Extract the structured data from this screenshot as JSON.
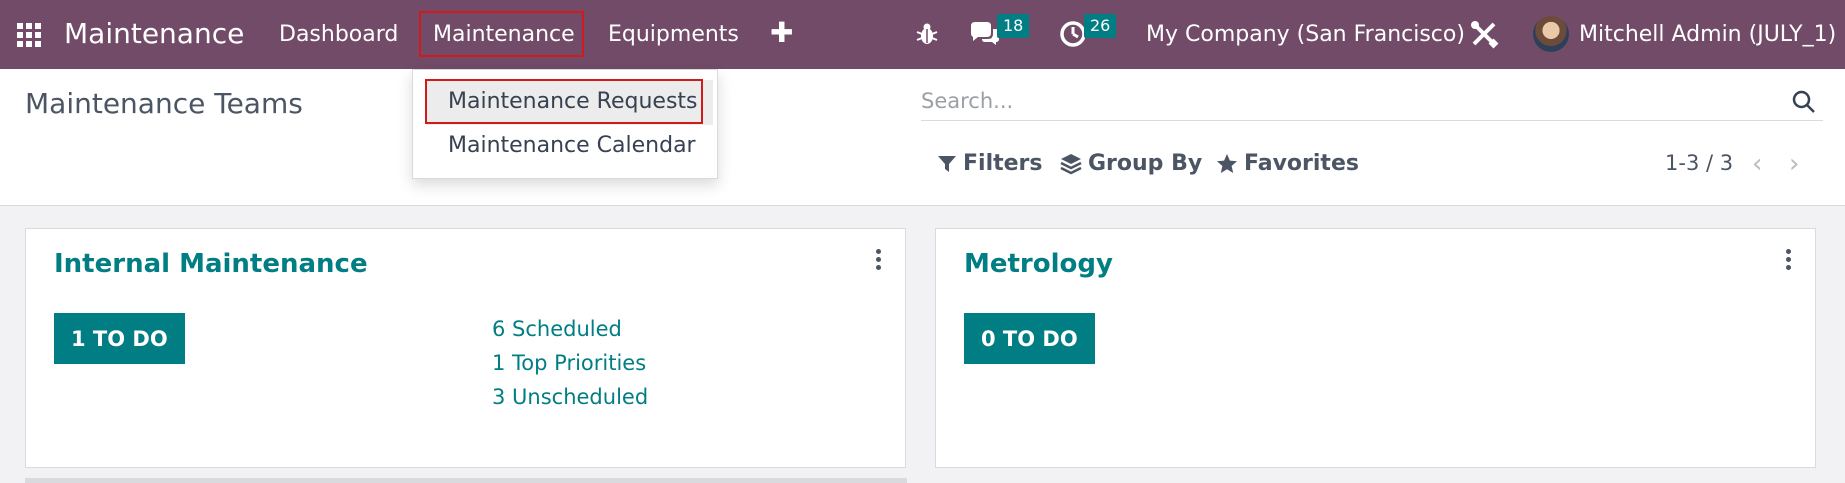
{
  "navbar": {
    "brand": "Maintenance",
    "items": [
      "Dashboard",
      "Maintenance",
      "Equipments"
    ],
    "plus": "✚",
    "chat_count": "18",
    "activity_count": "26",
    "company": "My Company (San Francisco)",
    "user": "Mitchell Admin (JULY_1)"
  },
  "dropdown": {
    "items": [
      "Maintenance Requests",
      "Maintenance Calendar"
    ]
  },
  "control": {
    "title": "Maintenance Teams",
    "search_placeholder": "Search...",
    "filters": "Filters",
    "group_by": "Group By",
    "favorites": "Favorites",
    "pager": "1-3 / 3"
  },
  "teams": [
    {
      "name": "Internal Maintenance",
      "todo": "1 TO DO",
      "stats": [
        "6 Scheduled",
        "1 Top Priorities",
        "3 Unscheduled"
      ]
    },
    {
      "name": "Metrology",
      "todo": "0 TO DO",
      "stats": []
    }
  ],
  "colors": {
    "navbar": "#714b67",
    "accent": "#017e84",
    "highlight": "#d11a1a"
  }
}
